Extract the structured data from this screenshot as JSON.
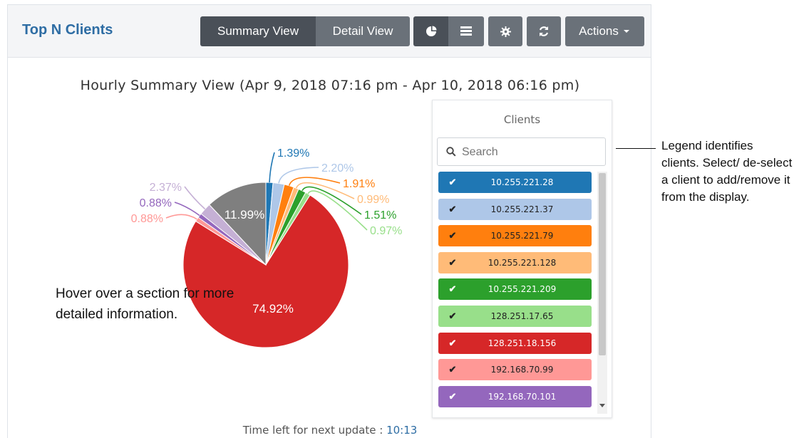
{
  "header": {
    "title": "Top N Clients",
    "summary_view_label": "Summary View",
    "detail_view_label": "Detail View",
    "actions_label": "Actions",
    "icons": [
      "pie-chart-icon",
      "table-icon",
      "gear-icon",
      "refresh-icon",
      "caret-down-icon"
    ]
  },
  "chart_data": {
    "type": "pie",
    "title": "Hourly Summary View (Apr 9, 2018 07:16 pm - Apr 10, 2018 06:16 pm)",
    "series": [
      {
        "name": "10.255.221.28",
        "value": 1.39,
        "label": "1.39%",
        "color": "#1f77b4"
      },
      {
        "name": "10.255.221.37",
        "value": 2.2,
        "label": "2.20%",
        "color": "#aec7e8"
      },
      {
        "name": "10.255.221.79",
        "value": 1.91,
        "label": "1.91%",
        "color": "#ff7f0e"
      },
      {
        "name": "10.255.221.128",
        "value": 0.99,
        "label": "0.99%",
        "color": "#ffbb78"
      },
      {
        "name": "10.255.221.209",
        "value": 1.51,
        "label": "1.51%",
        "color": "#2ca02c"
      },
      {
        "name": "128.251.17.65",
        "value": 0.97,
        "label": "0.97%",
        "color": "#98df8a"
      },
      {
        "name": "128.251.18.156",
        "value": 74.92,
        "label": "74.92%",
        "color": "#d62728"
      },
      {
        "name": "192.168.70.99",
        "value": 0.88,
        "label": "0.88%",
        "color": "#ff9896"
      },
      {
        "name": "192.168.70.101",
        "value": 0.88,
        "label": "0.88%",
        "color": "#9467bd"
      },
      {
        "name": "",
        "value": 2.37,
        "label": "2.37%",
        "color": "#c5b0d5"
      },
      {
        "name": "",
        "value": 11.99,
        "label": "11.99%",
        "color": "#7f7f7f"
      }
    ]
  },
  "legend": {
    "title": "Clients",
    "search_placeholder": "Search",
    "items": [
      {
        "label": "10.255.221.28",
        "color": "#1f77b4",
        "text_color": "#ffffff"
      },
      {
        "label": "10.255.221.37",
        "color": "#aec7e8",
        "text_color": "#222222"
      },
      {
        "label": "10.255.221.79",
        "color": "#ff7f0e",
        "text_color": "#222222"
      },
      {
        "label": "10.255.221.128",
        "color": "#ffbb78",
        "text_color": "#222222"
      },
      {
        "label": "10.255.221.209",
        "color": "#2ca02c",
        "text_color": "#ffffff"
      },
      {
        "label": "128.251.17.65",
        "color": "#98df8a",
        "text_color": "#222222"
      },
      {
        "label": "128.251.18.156",
        "color": "#d62728",
        "text_color": "#ffffff"
      },
      {
        "label": "192.168.70.99",
        "color": "#ff9896",
        "text_color": "#222222"
      },
      {
        "label": "192.168.70.101",
        "color": "#9467bd",
        "text_color": "#ffffff"
      }
    ]
  },
  "footer": {
    "label": "Time left for next update :",
    "timer": "10:13"
  },
  "annotations": {
    "legend_note": "Legend identifies clients. Select/ de-select a client to add/remove it from the display.",
    "hover_note": "Hover over a section for more detailed information."
  }
}
